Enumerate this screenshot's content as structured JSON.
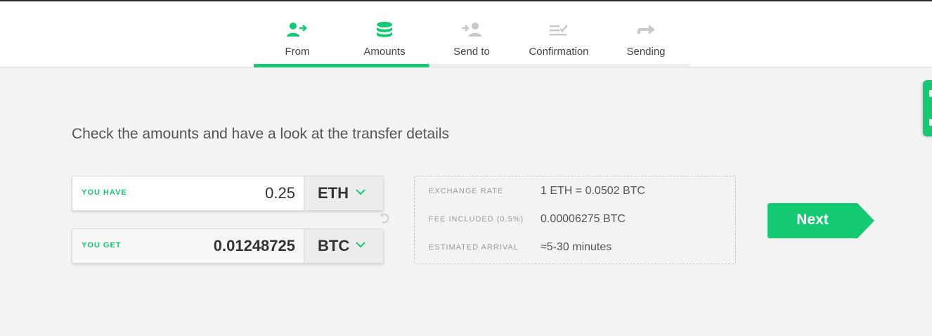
{
  "steps": [
    {
      "label": "From",
      "icon": "user-transfer-icon"
    },
    {
      "label": "Amounts",
      "icon": "coins-stack-icon"
    },
    {
      "label": "Send to",
      "icon": "send-to-user-icon"
    },
    {
      "label": "Confirmation",
      "icon": "checklist-icon"
    },
    {
      "label": "Sending",
      "icon": "arrow-right-icon"
    }
  ],
  "active_step": "Amounts",
  "colors": {
    "accent": "#13c971",
    "inactive_icon": "#c8c8c8",
    "text": "#555555",
    "background": "#f3f3f3"
  },
  "title": "Check the amounts and have a look at the transfer details",
  "you_have": {
    "label": "YOU HAVE",
    "value": "0.25",
    "currency": "ETH"
  },
  "you_get": {
    "label": "YOU GET",
    "value": "0.01248725",
    "currency": "BTC"
  },
  "details": {
    "exchange_rate": {
      "label": "EXCHANGE RATE",
      "value": "1 ETH = 0.0502 BTC"
    },
    "fee": {
      "label": "FEE INCLUDED (0.5%)",
      "value": "0.00006275 BTC"
    },
    "arrival": {
      "label": "ESTIMATED ARRIVAL",
      "value": "≈5-30 minutes"
    }
  },
  "next_label": "Next"
}
